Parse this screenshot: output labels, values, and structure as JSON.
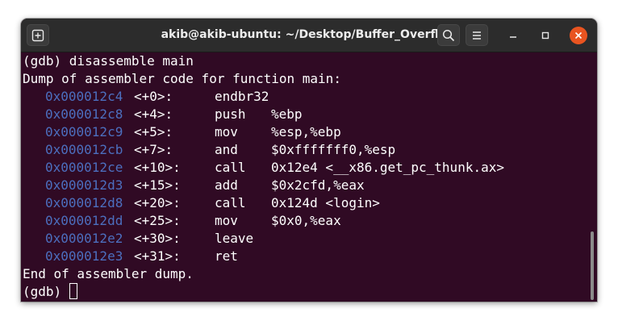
{
  "window": {
    "title": "akib@akib-ubuntu: ~/Desktop/Buffer_Overflow",
    "buttons": {
      "new_tab_icon": "new-tab-icon",
      "search_icon": "search-icon",
      "menu_icon": "hamburger-menu-icon",
      "minimize_icon": "minimize-icon",
      "maximize_icon": "maximize-icon",
      "close_icon": "close-icon"
    },
    "colors": {
      "titlebar": "#2c2c2c",
      "terminal_bg": "#300a24",
      "address": "#4c6fbf",
      "close_button": "#e95420"
    }
  },
  "terminal": {
    "command_line": "(gdb) disassemble main",
    "header_line": "Dump of assembler code for function main:",
    "instructions": [
      {
        "address": "0x000012c4",
        "offset": "<+0>:",
        "mnemonic": "endbr32",
        "operands": ""
      },
      {
        "address": "0x000012c8",
        "offset": "<+4>:",
        "mnemonic": "push",
        "operands": "%ebp"
      },
      {
        "address": "0x000012c9",
        "offset": "<+5>:",
        "mnemonic": "mov",
        "operands": "%esp,%ebp"
      },
      {
        "address": "0x000012cb",
        "offset": "<+7>:",
        "mnemonic": "and",
        "operands": "$0xfffffff0,%esp"
      },
      {
        "address": "0x000012ce",
        "offset": "<+10>:",
        "mnemonic": "call",
        "operands": "0x12e4 <__x86.get_pc_thunk.ax>"
      },
      {
        "address": "0x000012d3",
        "offset": "<+15>:",
        "mnemonic": "add",
        "operands": "$0x2cfd,%eax"
      },
      {
        "address": "0x000012d8",
        "offset": "<+20>:",
        "mnemonic": "call",
        "operands": "0x124d <login>"
      },
      {
        "address": "0x000012dd",
        "offset": "<+25>:",
        "mnemonic": "mov",
        "operands": "$0x0,%eax"
      },
      {
        "address": "0x000012e2",
        "offset": "<+30>:",
        "mnemonic": "leave",
        "operands": ""
      },
      {
        "address": "0x000012e3",
        "offset": "<+31>:",
        "mnemonic": "ret",
        "operands": ""
      }
    ],
    "footer_line": "End of assembler dump.",
    "prompt": "(gdb) "
  }
}
